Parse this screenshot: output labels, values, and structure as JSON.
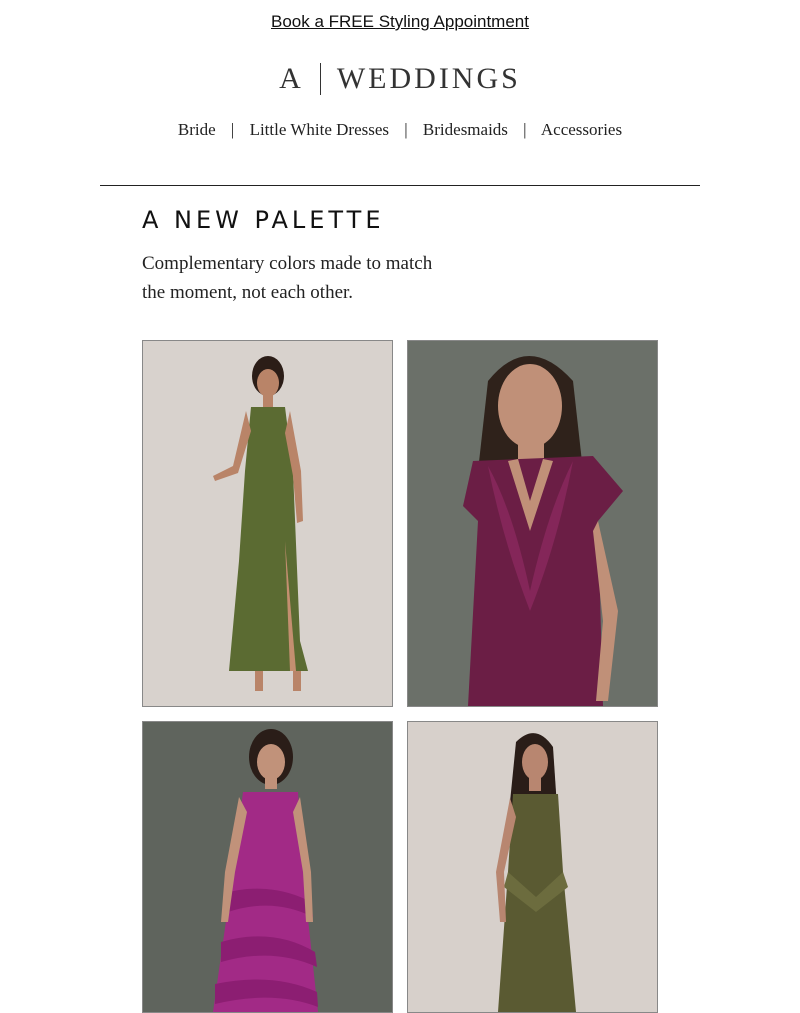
{
  "topbar": {
    "link_text": "Book a FREE Styling Appointment"
  },
  "brand": {
    "letter": "A",
    "name": "WEDDINGS"
  },
  "nav": {
    "items": [
      {
        "label": "Bride"
      },
      {
        "label": "Little White Dresses"
      },
      {
        "label": "Bridesmaids"
      },
      {
        "label": "Accessories"
      }
    ],
    "divider": "|"
  },
  "hero": {
    "headline": "A NEW PALETTE",
    "subcopy_line1": "Complementary colors made to match",
    "subcopy_line2": "the moment, not each other."
  },
  "products": [
    {
      "dress_color": "#5b6b32",
      "background": "#d8d2cd"
    },
    {
      "dress_color": "#6b1e45",
      "background": "#6b7069"
    },
    {
      "dress_color": "#a22a86",
      "background": "#5f645d"
    },
    {
      "dress_color": "#5a5a32",
      "background": "#d7d0cb"
    }
  ]
}
